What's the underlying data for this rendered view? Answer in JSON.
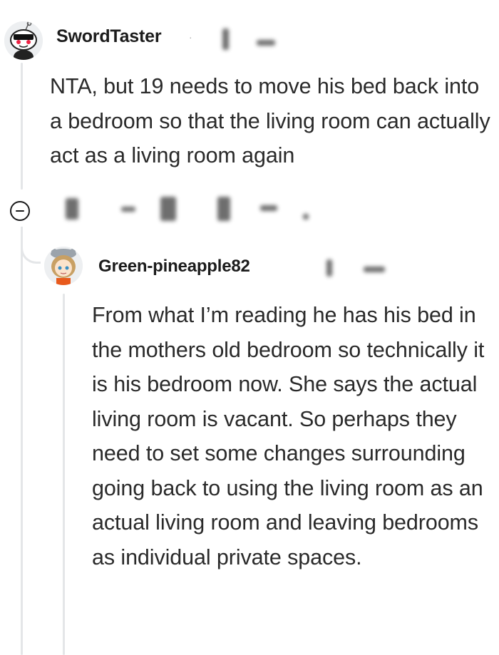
{
  "comment": {
    "username": "SwordTaster",
    "body": "NTA, but 19 needs to move his bed back into a bedroom so that the living room can actually act as a living room again",
    "actions": {
      "collapse_icon": "collapse-icon",
      "upvote_icon": "upvote-icon",
      "downvote_icon": "downvote-icon",
      "share_icon": "share-icon",
      "more_icon": "more-options-icon"
    }
  },
  "reply": {
    "username": "Green-pineapple82",
    "body": "From what I’m reading he has his bed in the mothers old bedroom so technically it is his bedroom now. She says the actual living room is vacant. So perhaps they need to set some changes surrounding going back to using the living room as an actual living room and leaving bedrooms as individual private spaces."
  },
  "colors": {
    "thread_line": "#e4e6e8",
    "text": "#2a2a2a",
    "username": "#1c1c1c"
  }
}
